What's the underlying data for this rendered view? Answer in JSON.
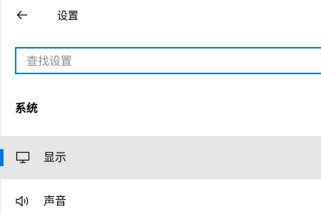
{
  "header": {
    "title": "设置",
    "back_icon": "back-arrow-icon"
  },
  "search": {
    "placeholder": "查找设置",
    "value": ""
  },
  "section": {
    "title": "系统"
  },
  "nav": {
    "items": [
      {
        "label": "显示",
        "icon": "monitor-icon",
        "selected": true
      },
      {
        "label": "声音",
        "icon": "speaker-icon",
        "selected": false
      }
    ]
  },
  "colors": {
    "accent": "#0078d7",
    "selected_bg": "#e6e6e6",
    "placeholder": "#8a8a8a"
  }
}
